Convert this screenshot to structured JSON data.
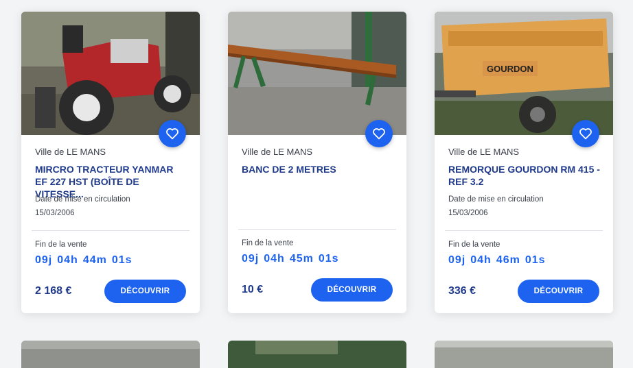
{
  "colors": {
    "accent": "#1d63f0",
    "title": "#1f3a8a",
    "background": "#f3f4f6"
  },
  "icons": {
    "favorite": "heart-outline-icon"
  },
  "listings": [
    {
      "city": "Ville de LE MANS",
      "title": "MIRCRO TRACTEUR YANMAR EF 227 HST (boîte de vitesse...",
      "date_label": "Date de mise en circulation",
      "date": "15/03/2006",
      "end_label": "Fin de la vente",
      "countdown": {
        "days": "09j",
        "hours": "04h",
        "minutes": "44m",
        "seconds": "01s"
      },
      "price": "2 168 €",
      "cta": "DÉCOUVRIR"
    },
    {
      "city": "Ville de LE MANS",
      "title": "BANC DE 2 METRES",
      "end_label": "Fin de la vente",
      "countdown": {
        "days": "09j",
        "hours": "04h",
        "minutes": "45m",
        "seconds": "01s"
      },
      "price": "10 €",
      "cta": "DÉCOUVRIR"
    },
    {
      "city": "Ville de LE MANS",
      "title": "REMORQUE GOURDON RM 415 - REF 3.2",
      "date_label": "Date de mise en circulation",
      "date": "15/03/2006",
      "end_label": "Fin de la vente",
      "countdown": {
        "days": "09j",
        "hours": "04h",
        "minutes": "46m",
        "seconds": "01s"
      },
      "price": "336 €",
      "cta": "DÉCOUVRIR",
      "image_text": "GOURDON"
    }
  ]
}
